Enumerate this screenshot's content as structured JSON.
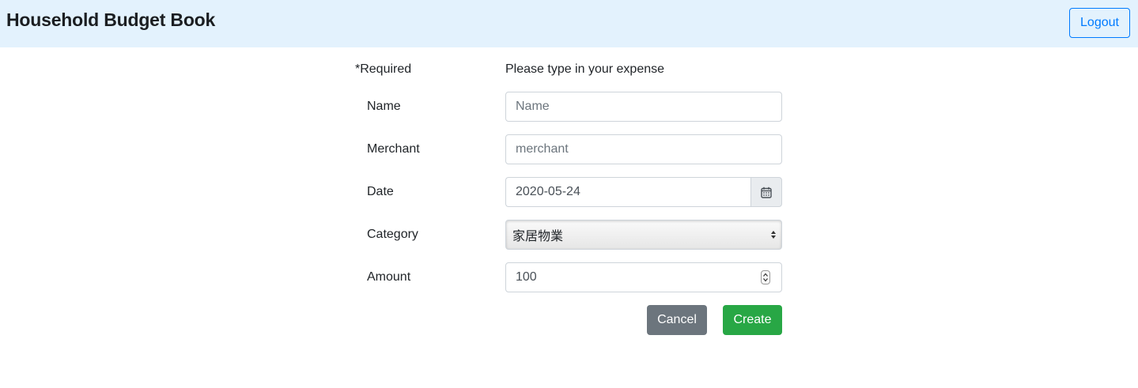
{
  "app": {
    "title": "Household Budget Book",
    "logout_label": "Logout"
  },
  "form": {
    "required_note": "*Required",
    "intro": "Please type in your expense",
    "fields": {
      "name": {
        "label": "Name",
        "value": "",
        "placeholder": "Name"
      },
      "merchant": {
        "label": "Merchant",
        "value": "",
        "placeholder": "merchant"
      },
      "date": {
        "label": "Date",
        "value": "2020-05-24",
        "icon": "calendar-icon"
      },
      "category": {
        "label": "Category",
        "selected": "家居物業"
      },
      "amount": {
        "label": "Amount",
        "value": "100"
      }
    },
    "buttons": {
      "cancel": "Cancel",
      "create": "Create"
    }
  },
  "colors": {
    "navbar_bg": "#e3f2fd",
    "primary": "#007bff",
    "cancel": "#6c757d",
    "create": "#28a745"
  }
}
